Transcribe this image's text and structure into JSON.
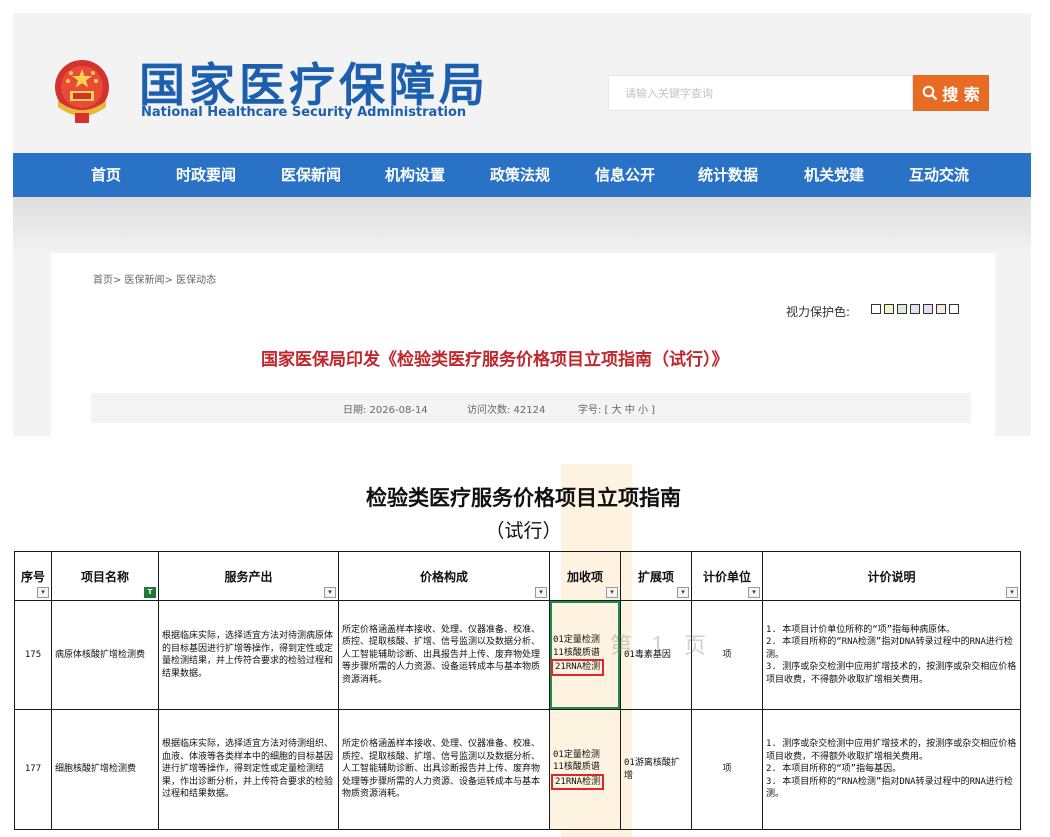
{
  "website": {
    "logo_cn": "国家医疗保障局",
    "logo_en": "National Healthcare Security Administration",
    "search": {
      "placeholder": "请输入关键字查询",
      "button_label": "搜 索"
    },
    "nav": [
      "首页",
      "时政要闻",
      "医保新闻",
      "机构设置",
      "政策法规",
      "信息公开",
      "统计数据",
      "机关党建",
      "互动交流"
    ],
    "breadcrumb": "首页> 医保新闻> 医保动态",
    "vision_label": "视力保护色:",
    "vision_swatches": [
      "#ffffff",
      "#f6f2c8",
      "#dcebd6",
      "#e0e4f2",
      "#eadcf0",
      "#f6e6e0",
      "#ffffff"
    ],
    "article_title": "国家医保局印发《检验类医疗服务价格项目立项指南（试行）》",
    "meta": {
      "date": "日期: 2026-08-14",
      "visits": "访问次数: 42124",
      "fontsize": "字号: [ 大 中 小 ]"
    },
    "colors": {
      "brand_blue": "#2a72c6",
      "search_orange": "#e86b23",
      "title_red": "#c0272d"
    }
  },
  "sheet": {
    "title": "检验类医疗服务价格项目立项指南",
    "subtitle": "（试行）",
    "headers": [
      "序号",
      "项目名称",
      "服务产出",
      "价格构成",
      "加收项",
      "扩展项",
      "计价单位",
      "计价说明"
    ],
    "watermark": "第 1 页",
    "rows": [
      {
        "no": "175",
        "name": "病原体核酸扩增检测费",
        "output": "根据临床实际，选择适宜方法对待测病原体的目标基因进行扩增等操作，得到定性或定量检测结果，并上传符合要求的检验过程和结果数据。",
        "price": "所定价格涵盖样本接收、处理、仪器准备、校准、质控、提取核酸、扩增、信号监测以及数据分析、人工智能辅助诊断、出具报告并上传、废弃物处理等步骤所需的人力资源、设备运转成本与基本物质资源消耗。",
        "addons": [
          "01定量检测",
          "11核酸质谱",
          "21RNA检测"
        ],
        "ext": "01毒素基因",
        "unit": "项",
        "notes": [
          "1. 本项目计价单位所称的“项”指每种病原体。",
          "2. 本项目所称的“RNA检测”指对DNA转录过程中的RNA进行检测。",
          "3. 测序或杂交检测中应用扩增技术的，按测序或杂交相应价格项目收费，不得额外收取扩增相关费用。"
        ]
      },
      {
        "no": "177",
        "name": "细胞核酸扩增检测费",
        "output": "根据临床实际，选择适宜方法对待测组织、血液、体液等各类样本中的细胞的目标基因进行扩增等操作，得到定性或定量检测结果，作出诊断分析，并上传符合要求的检验过程和结果数据。",
        "price": "所定价格涵盖样本接收、处理、仪器准备、校准、质控、提取核酸、扩增、信号监测以及数据分析、人工智能辅助诊断、出具诊断报告并上传、废弃物处理等步骤所需的人力资源、设备运转成本与基本物质资源消耗。",
        "addons": [
          "01定量检测",
          "11核酸质谱",
          "21RNA检测"
        ],
        "ext": "01游离核酸扩增",
        "unit": "项",
        "notes": [
          "1. 测序或杂交检测中应用扩增技术的，按测序或杂交相应价格项目收费，不得额外收取扩增相关费用。",
          "2. 本项目所称的“项”指每基因。",
          "3. 本项目所称的“RNA检测”指对DNA转录过程中的RNA进行检测。"
        ]
      }
    ]
  }
}
